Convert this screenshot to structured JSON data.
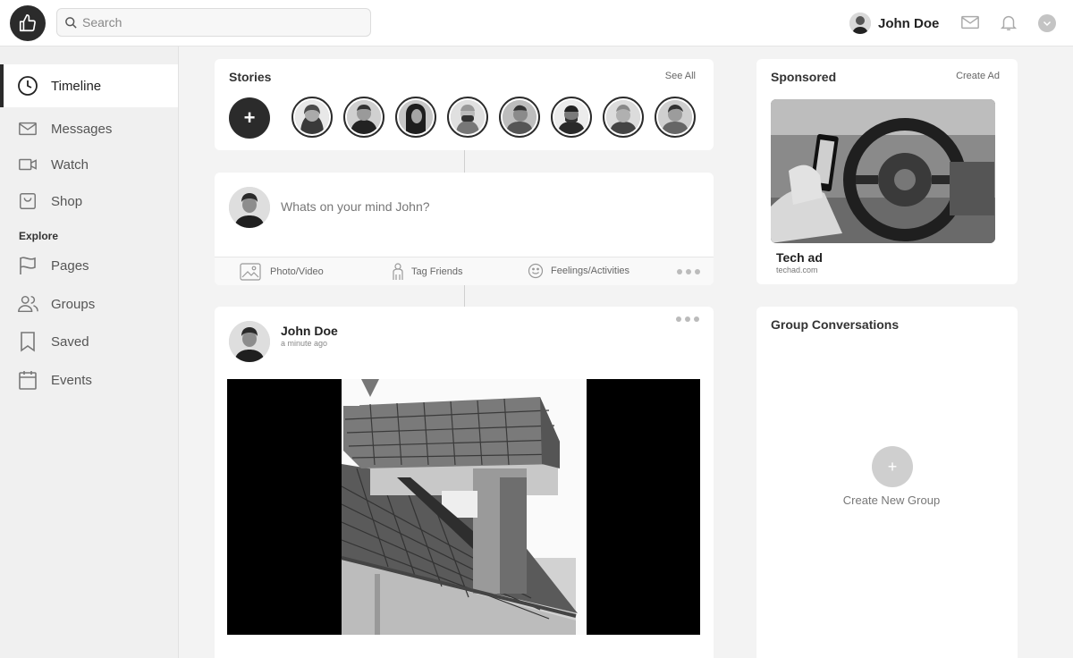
{
  "header": {
    "search_placeholder": "Search",
    "user_name": "John Doe",
    "icons": [
      "thumbs-up-icon",
      "search-icon",
      "mail-icon",
      "bell-icon",
      "chevron-down-icon"
    ]
  },
  "sidebar": {
    "items": [
      {
        "label": "Timeline",
        "icon": "clock-icon",
        "active": true
      },
      {
        "label": "Messages",
        "icon": "mail-icon"
      },
      {
        "label": "Watch",
        "icon": "video-icon"
      },
      {
        "label": "Shop",
        "icon": "shopping-bag-icon"
      }
    ],
    "explore_label": "Explore",
    "explore_items": [
      {
        "label": "Pages",
        "icon": "flag-icon"
      },
      {
        "label": "Groups",
        "icon": "users-icon"
      },
      {
        "label": "Saved",
        "icon": "bookmark-icon"
      },
      {
        "label": "Events",
        "icon": "calendar-icon"
      }
    ]
  },
  "stories": {
    "title": "Stories",
    "see_all": "See All",
    "add_label": "+",
    "count": 8
  },
  "composer": {
    "placeholder": "Whats on your mind John?",
    "actions": [
      {
        "label": "Photo/Video",
        "icon": "image-icon"
      },
      {
        "label": "Tag Friends",
        "icon": "person-icon"
      },
      {
        "label": "Feelings/Activities",
        "icon": "smile-icon"
      }
    ]
  },
  "post": {
    "author": "John Doe",
    "time": "a minute ago"
  },
  "sponsored": {
    "title": "Sponsored",
    "create_ad": "Create Ad",
    "ad_title": "Tech ad",
    "ad_domain": "techad.com"
  },
  "groups": {
    "title": "Group Conversations",
    "create_label": "Create New Group",
    "plus": "+"
  }
}
